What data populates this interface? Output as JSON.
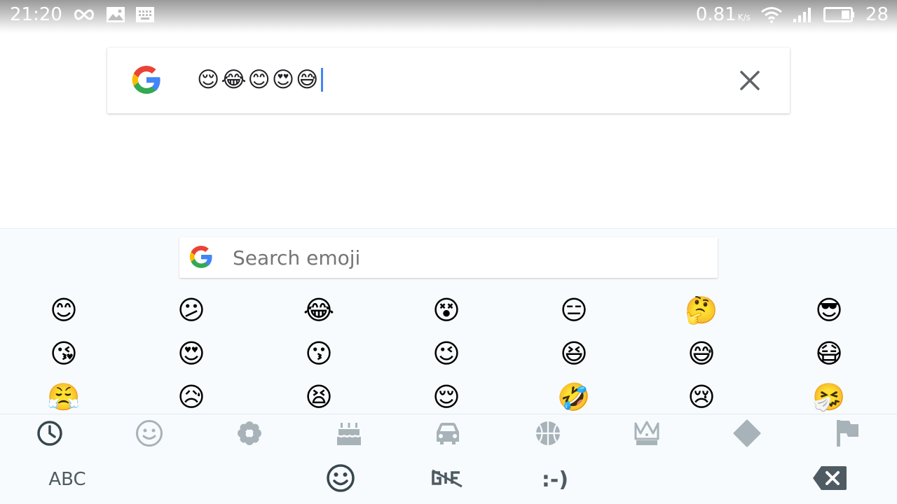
{
  "status_bar": {
    "time": "21:20",
    "network_speed": "0.81",
    "network_unit": "K/s",
    "battery_level": "28",
    "icons": [
      "infinity-icon",
      "image-icon",
      "keyboard-icon",
      "wifi-icon",
      "signal-icon",
      "battery-icon"
    ]
  },
  "search_box": {
    "query": "😌😂😊😍😅",
    "logo": "google-g-logo",
    "clear_icon": "close-icon"
  },
  "emoji_keyboard": {
    "search_placeholder": "Search emoji",
    "emoji_rows": [
      [
        "😊",
        "😕",
        "😂",
        "😵",
        "😑",
        "🤔",
        "😎"
      ],
      [
        "😘",
        "😍",
        "😗",
        "😉",
        "😆",
        "😅",
        "😷"
      ],
      [
        "😤",
        "😥",
        "😫",
        "😌",
        "🤣",
        "😢",
        "🤧"
      ]
    ],
    "categories": [
      {
        "name": "recent",
        "icon": "clock-icon",
        "selected": true
      },
      {
        "name": "smileys",
        "icon": "smiley-icon",
        "selected": false
      },
      {
        "name": "nature",
        "icon": "flower-icon",
        "selected": false
      },
      {
        "name": "food",
        "icon": "cake-icon",
        "selected": false
      },
      {
        "name": "travel",
        "icon": "car-icon",
        "selected": false
      },
      {
        "name": "activities",
        "icon": "ball-icon",
        "selected": false
      },
      {
        "name": "objects",
        "icon": "crown-icon",
        "selected": false
      },
      {
        "name": "symbols",
        "icon": "diamond-icon",
        "selected": false
      },
      {
        "name": "flags",
        "icon": "flag-icon",
        "selected": false
      }
    ],
    "bottom_row": {
      "abc_label": "ABC",
      "emoticon_label": ":-)",
      "gif_icon": "gif-off-icon",
      "emoji_icon": "emoji-face-icon",
      "delete_icon": "backspace-icon"
    },
    "colors": {
      "selected_icon": "#37474f",
      "unselected_icon": "#a7b3b9",
      "background": "#f8fbfd"
    }
  }
}
